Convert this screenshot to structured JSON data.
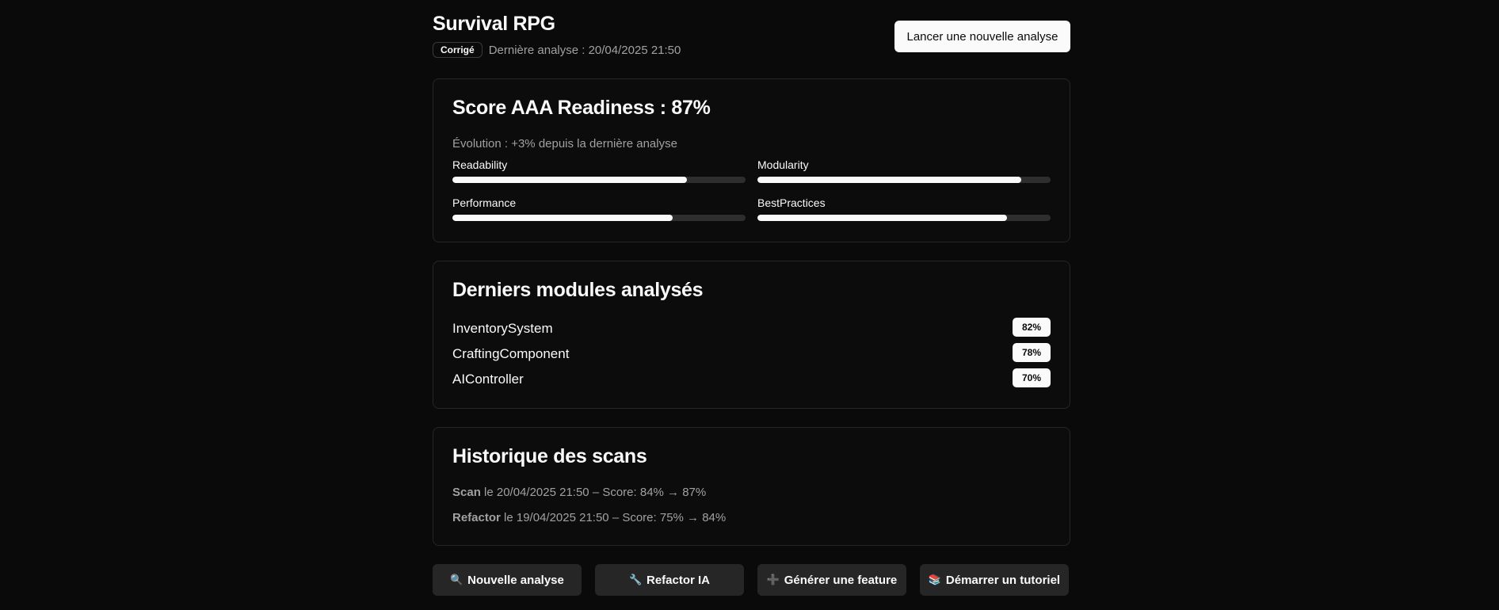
{
  "header": {
    "title": "Survival RPG",
    "status_badge": "Corrigé",
    "last_analysis": "Dernière analyse : 20/04/2025 21:50",
    "primary_action": "Lancer une nouvelle analyse"
  },
  "score_card": {
    "title": "Score AAA Readiness : 87%",
    "evolution": "Évolution : +3% depuis la dernière analyse",
    "metrics": [
      {
        "label": "Readability",
        "level": 0.8
      },
      {
        "label": "Modularity",
        "level": 0.9
      },
      {
        "label": "Performance",
        "level": 0.75
      },
      {
        "label": "BestPractices",
        "level": 0.85
      }
    ]
  },
  "modules_card": {
    "title": "Derniers modules analysés",
    "modules": [
      {
        "name": "InventorySystem",
        "score": "82%"
      },
      {
        "name": "CraftingComponent",
        "score": "78%"
      },
      {
        "name": "AIController",
        "score": "70%"
      }
    ]
  },
  "history_card": {
    "title": "Historique des scans",
    "entries": [
      {
        "type": "Scan",
        "detail": "le 20/04/2025 21:50 – Score: 84% → 87%"
      },
      {
        "type": "Refactor",
        "detail": "le 19/04/2025 21:50 – Score: 75% → 84%"
      }
    ]
  },
  "actions": [
    {
      "icon": "magnifier-icon",
      "glyph": "🔍",
      "label": "Nouvelle analyse"
    },
    {
      "icon": "wrench-icon",
      "glyph": "🔧",
      "label": "Refactor IA"
    },
    {
      "icon": "plus-icon",
      "glyph": "➕",
      "label": "Générer une feature"
    },
    {
      "icon": "books-icon",
      "glyph": "📚",
      "label": "Démarrer un tutoriel"
    }
  ],
  "colors": {
    "background": "#0a0a0a",
    "card_border": "#262626",
    "bar_fill": "#fafafa",
    "bar_track": "#2e2e2e",
    "muted_text": "#a1a1a1",
    "plus_icon": "#8b5cf6"
  }
}
